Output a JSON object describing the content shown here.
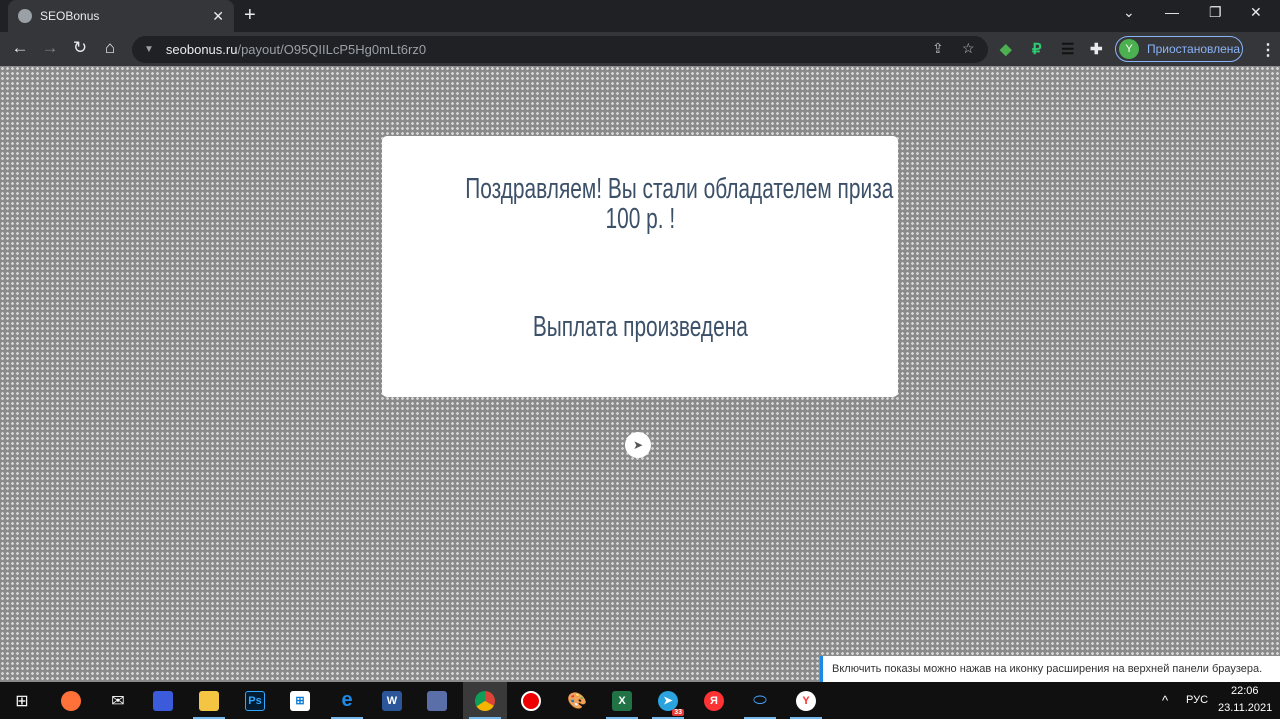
{
  "browser": {
    "tab_title": "SEOBonus",
    "url_host": "seobonus.ru",
    "url_path": "/payout/O95QIILcP5Hg0mLt6rz0",
    "profile_initial": "Y",
    "profile_status": "Приостановлена"
  },
  "card": {
    "title_line1": "Поздравляем! Вы стали обладателем приза",
    "title_line2": "100 р. !",
    "status": "Выплата произведена"
  },
  "notice": "Включить показы можно нажав на иконку расширения на верхней панели браузера.",
  "taskbar": {
    "telegram_badge": "33",
    "language": "РУС",
    "time": "22:06",
    "date": "23.11.2021"
  },
  "colors": {
    "card_text": "#3c5068",
    "accent": "#1e88e5"
  }
}
